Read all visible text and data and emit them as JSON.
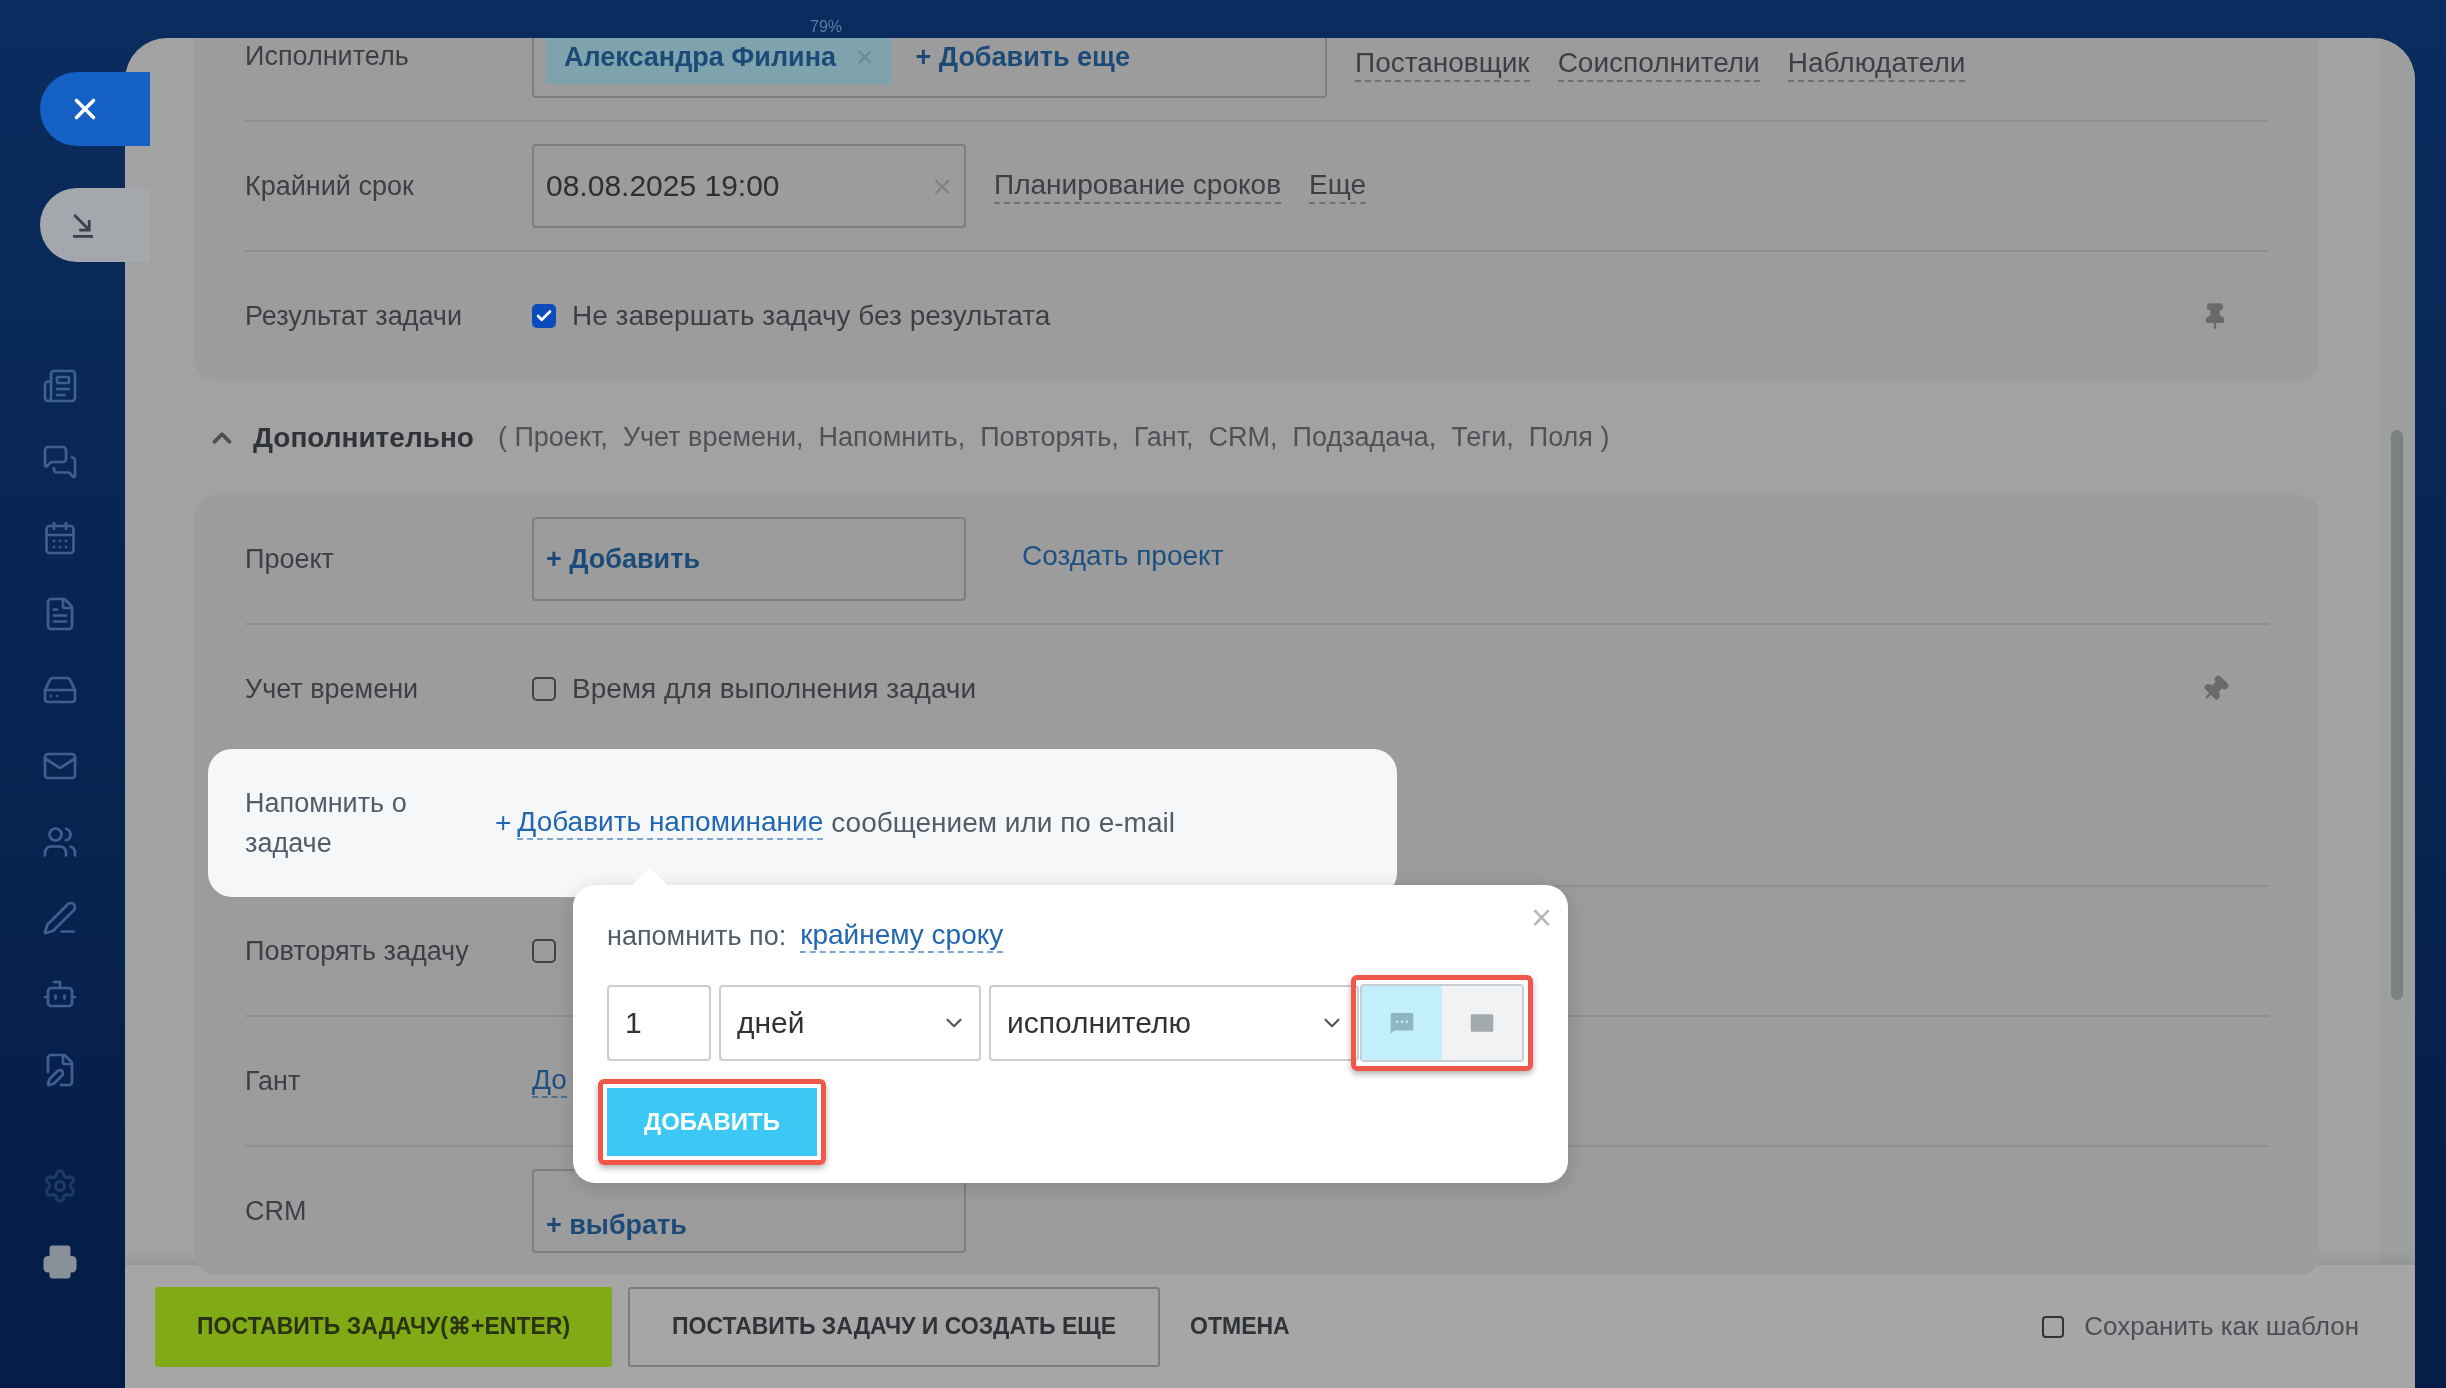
{
  "topbar": {
    "zoom": "79%"
  },
  "main_section": {
    "rows": [
      {
        "kind": "responsible",
        "label": "Исполнитель",
        "tag": "Александра Филина",
        "tag_remove": "×",
        "add": "+ Добавить еще",
        "links": [
          "Постановщик",
          "Соисполнители",
          "Наблюдатели"
        ]
      },
      {
        "kind": "deadline",
        "label": "Крайний срок",
        "value": "08.08.2025 19:00",
        "clear": "×",
        "links": [
          "Планирование сроков",
          "Еще"
        ]
      },
      {
        "kind": "checkbox",
        "label": "Результат задачи",
        "checkbox_label": "Не завершать задачу без результата",
        "checked": true,
        "pinned": true
      }
    ]
  },
  "additional": {
    "title": "Дополнительно",
    "expanded": true,
    "summary": "( Проект,  Учет времени,  Напомнить,  Повторять,  Гант,  CRM,  Подзадача,  Теги,  Поля )",
    "rows": [
      {
        "kind": "button_field",
        "label": "Проект",
        "button": "+ Добавить",
        "link": "Создать проект"
      },
      {
        "kind": "checkbox",
        "label": "Учет времени",
        "checkbox_label": "Время для выполнения задачи",
        "checked": false,
        "pinned": false
      },
      {
        "kind": "reminder",
        "label": "Напомнить о задаче",
        "highlighted": true,
        "plus": "+",
        "link": "Добавить напоминание",
        "text": "сообщением или по e-mail"
      },
      {
        "kind": "checkbox",
        "label": "Повторять задачу",
        "checked": false
      },
      {
        "kind": "link",
        "label": "Гант",
        "link": "До"
      },
      {
        "kind": "button_field",
        "label": "CRM",
        "button": "+ выбрать"
      }
    ]
  },
  "popup": {
    "label": "напомнить по:",
    "type_link": "крайнему сроку",
    "close": "×",
    "amount": "1",
    "unit": "дней",
    "recipient": "исполнителю",
    "channels": [
      {
        "kind": "message",
        "selected": true
      },
      {
        "kind": "email",
        "selected": false
      }
    ],
    "submit": "ДОБАВИТЬ"
  },
  "footer": {
    "submit": "ПОСТАВИТЬ ЗАДАЧУ(⌘+ENTER)",
    "submit_more": "ПОСТАВИТЬ ЗАДАЧУ И СОЗДАТЬ ЕЩЕ",
    "cancel": "ОТМЕНА",
    "template": {
      "label": "Сохранить как шаблон",
      "checked": false
    }
  }
}
